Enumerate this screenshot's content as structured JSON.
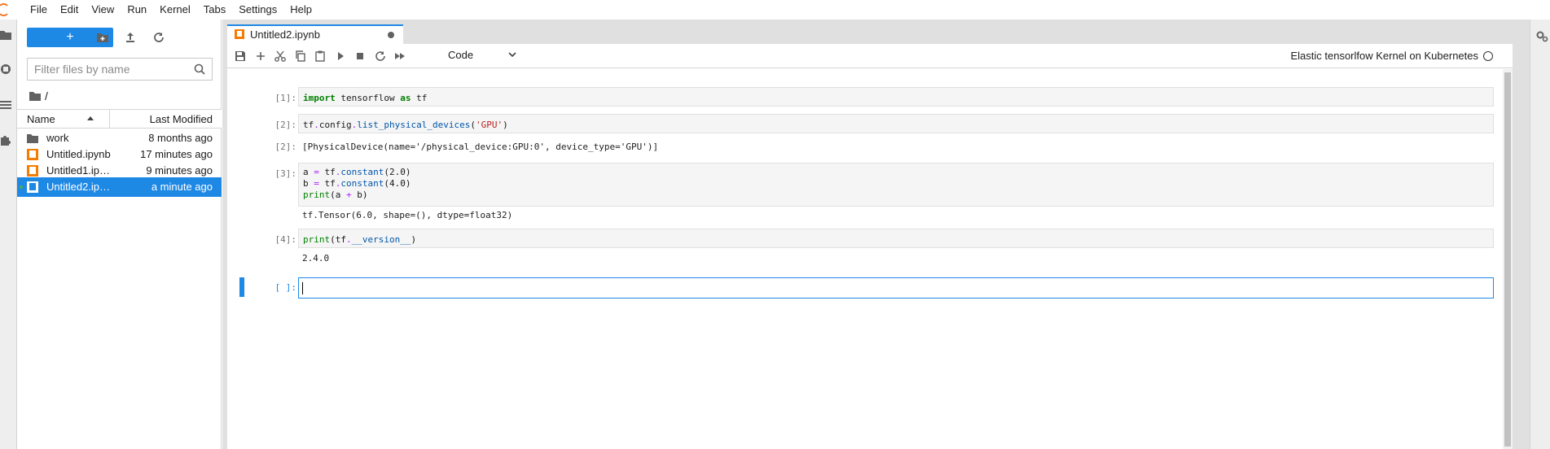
{
  "menu": {
    "items": [
      "File",
      "Edit",
      "View",
      "Run",
      "Kernel",
      "Tabs",
      "Settings",
      "Help"
    ]
  },
  "filebrowser": {
    "new_label": "+",
    "filter_placeholder": "Filter files by name",
    "breadcrumb": "/",
    "columns": {
      "name": "Name",
      "modified": "Last Modified"
    },
    "files": [
      {
        "name": "work",
        "modified": "8 months ago",
        "icon": "folder-icon"
      },
      {
        "name": "Untitled.ipynb",
        "modified": "17 minutes ago",
        "icon": "notebook-icon"
      },
      {
        "name": "Untitled1.ipynb",
        "modified": "9 minutes ago",
        "icon": "notebook-icon"
      },
      {
        "name": "Untitled2.ipynb",
        "modified": "a minute ago",
        "icon": "notebook-icon",
        "selected": true
      }
    ]
  },
  "tab": {
    "label": "Untitled2.ipynb"
  },
  "toolbar": {
    "cell_type": "Code",
    "kernel": "Elastic tensorlfow Kernel on Kubernetes"
  },
  "cells": {
    "c1_prompt": "[1]:",
    "c2_prompt": "[2]:",
    "c2_output": "[PhysicalDevice(name='/physical_device:GPU:0', device_type='GPU')]",
    "c3_prompt": "[3]:",
    "c3_output": "tf.Tensor(6.0, shape=(), dtype=float32)",
    "c4_prompt": "[4]:",
    "c4_output": "2.4.0",
    "c5_prompt": "[ ]:"
  },
  "colors": {
    "accent": "#1e88e5",
    "notebook": "#f57c00"
  }
}
